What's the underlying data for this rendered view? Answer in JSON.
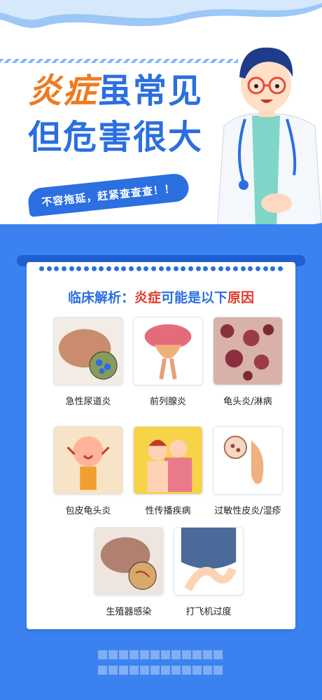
{
  "headline": {
    "line1_accent": "炎症",
    "line1_rest": "虽常见",
    "line2": "但危害很大"
  },
  "slogan": "不容拖延，赶紧查查查！！",
  "card": {
    "title_prefix": "临床解析：",
    "title_accent": "炎症",
    "title_mid": "可能是以下",
    "title_accent2": "原因"
  },
  "items": [
    {
      "label": "急性尿道炎",
      "icon": "urethritis-illustration"
    },
    {
      "label": "前列腺炎",
      "icon": "prostate-illustration"
    },
    {
      "label": "龟头炎/淋病",
      "icon": "microscope-cells-illustration"
    },
    {
      "label": "包皮龟头炎",
      "icon": "itching-person-illustration"
    },
    {
      "label": "性传播疾病",
      "icon": "couple-illustration"
    },
    {
      "label": "过敏性皮炎/湿疹",
      "icon": "allergy-illustration"
    },
    {
      "label": "生殖器感染",
      "icon": "infection-illustration"
    },
    {
      "label": "打飞机过度",
      "icon": "hands-illustration"
    }
  ],
  "colors": {
    "primary": "#2b6fe0",
    "accent_orange": "#f07a1f",
    "accent_red": "#e03a2b",
    "background_blue": "#3b82f0"
  }
}
